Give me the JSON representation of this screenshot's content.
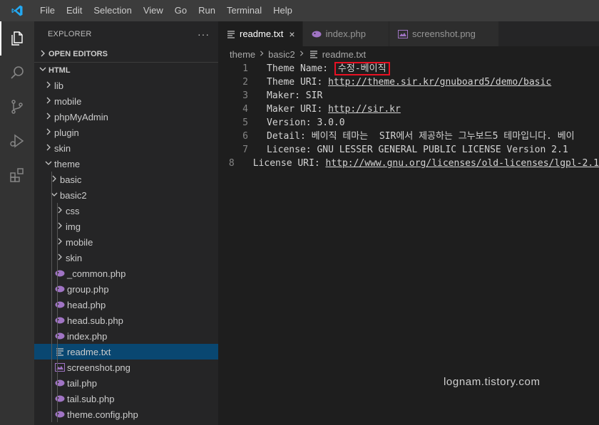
{
  "menu": [
    "File",
    "Edit",
    "Selection",
    "View",
    "Go",
    "Run",
    "Terminal",
    "Help"
  ],
  "activity": [
    "explorer-icon",
    "search-icon",
    "source-control-icon",
    "run-debug-icon",
    "extensions-icon"
  ],
  "sidebar": {
    "title": "EXPLORER",
    "more": "···",
    "open_editors": "OPEN EDITORS",
    "workspace": "HTML",
    "tree": [
      {
        "label": "lib",
        "type": "folder",
        "depth": 0,
        "expanded": false
      },
      {
        "label": "mobile",
        "type": "folder",
        "depth": 0,
        "expanded": false
      },
      {
        "label": "phpMyAdmin",
        "type": "folder",
        "depth": 0,
        "expanded": false
      },
      {
        "label": "plugin",
        "type": "folder",
        "depth": 0,
        "expanded": false
      },
      {
        "label": "skin",
        "type": "folder",
        "depth": 0,
        "expanded": false
      },
      {
        "label": "theme",
        "type": "folder",
        "depth": 0,
        "expanded": true
      },
      {
        "label": "basic",
        "type": "folder",
        "depth": 1,
        "expanded": false
      },
      {
        "label": "basic2",
        "type": "folder",
        "depth": 1,
        "expanded": true
      },
      {
        "label": "css",
        "type": "folder",
        "depth": 2,
        "expanded": false
      },
      {
        "label": "img",
        "type": "folder",
        "depth": 2,
        "expanded": false
      },
      {
        "label": "mobile",
        "type": "folder",
        "depth": 2,
        "expanded": false
      },
      {
        "label": "skin",
        "type": "folder",
        "depth": 2,
        "expanded": false
      },
      {
        "label": "_common.php",
        "type": "php",
        "depth": 2
      },
      {
        "label": "group.php",
        "type": "php",
        "depth": 2
      },
      {
        "label": "head.php",
        "type": "php",
        "depth": 2
      },
      {
        "label": "head.sub.php",
        "type": "php",
        "depth": 2
      },
      {
        "label": "index.php",
        "type": "php",
        "depth": 2
      },
      {
        "label": "readme.txt",
        "type": "txt",
        "depth": 2,
        "selected": true
      },
      {
        "label": "screenshot.png",
        "type": "png",
        "depth": 2
      },
      {
        "label": "tail.php",
        "type": "php",
        "depth": 2
      },
      {
        "label": "tail.sub.php",
        "type": "php",
        "depth": 2
      },
      {
        "label": "theme.config.php",
        "type": "php",
        "depth": 2
      }
    ]
  },
  "tabs": [
    {
      "label": "readme.txt",
      "type": "txt",
      "active": true,
      "close": "×"
    },
    {
      "label": "index.php",
      "type": "php",
      "active": false
    },
    {
      "label": "screenshot.png",
      "type": "png",
      "active": false
    }
  ],
  "breadcrumb": [
    "theme",
    "basic2",
    "readme.txt"
  ],
  "editor": {
    "lines": [
      {
        "num": "1",
        "key": "Theme Name: ",
        "value": "수정-베이직",
        "highlight": true
      },
      {
        "num": "2",
        "key": "Theme URI: ",
        "value": "http://theme.sir.kr/gnuboard5/demo/basic",
        "link": true
      },
      {
        "num": "3",
        "key": "Maker: SIR",
        "value": ""
      },
      {
        "num": "4",
        "key": "Maker URI: ",
        "value": "http://sir.kr",
        "link": true
      },
      {
        "num": "5",
        "key": "Version: 3.0.0",
        "value": ""
      },
      {
        "num": "6",
        "key": "Detail: 베이직 테마는  SIR에서 제공하는 그누보드5 테마입니다. 베이",
        "value": ""
      },
      {
        "num": "7",
        "key": "License: GNU LESSER GENERAL PUBLIC LICENSE Version 2.1",
        "value": ""
      },
      {
        "num": "8",
        "key": "License URI: ",
        "value": "http://www.gnu.org/licenses/old-licenses/lgpl-2.1",
        "link": true
      }
    ]
  },
  "watermark": "lognam.tistory.com",
  "colors": {
    "accent": "#007acc",
    "selection": "#094771",
    "php_icon": "#a074c4",
    "highlight_box": "#e81123"
  }
}
